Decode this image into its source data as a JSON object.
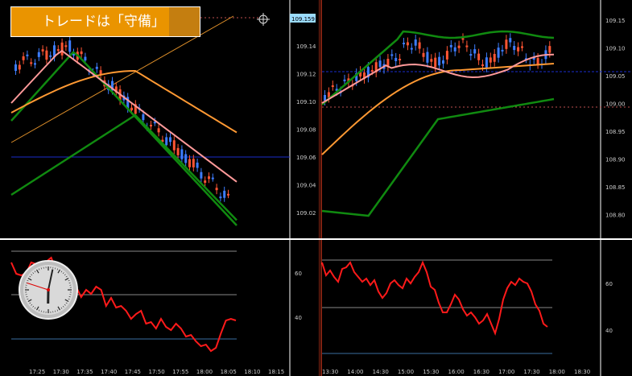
{
  "title": "トレードは「守備」",
  "colors": {
    "background": "#000000",
    "bull": "#ff5533",
    "bear": "#3d7dff",
    "fast_ma": "#ff9a9a",
    "slow_ma": "#ff9933",
    "band": "#108a10",
    "rsi": "#ff1a1a",
    "divider": "#ffffff",
    "session_line": "#ff4422",
    "price_tag": "#9bdcff"
  },
  "left": {
    "price_axis": [
      "109.14",
      "109.12",
      "109.10",
      "109.08",
      "109.06",
      "109.04",
      "109.02"
    ],
    "price_tag": "109.159",
    "time_axis": [
      "17:25",
      "17:30",
      "17:35",
      "17:40",
      "17:45",
      "17:50",
      "17:55",
      "18:00",
      "18:05",
      "18:10",
      "18:15"
    ],
    "rsi_axis": [
      "60",
      "40"
    ]
  },
  "right": {
    "price_axis": [
      "109.15",
      "109.10",
      "109.05",
      "109.00",
      "108.95",
      "108.90",
      "108.85",
      "108.80"
    ],
    "time_axis": [
      "13:30",
      "14:00",
      "14:30",
      "15:00",
      "15:30",
      "16:00",
      "16:30",
      "17:00",
      "17:30",
      "18:00",
      "18:30"
    ],
    "rsi_axis": [
      "60",
      "40"
    ]
  },
  "clock": {
    "hour": 6,
    "minute": 2,
    "second": 48
  }
}
